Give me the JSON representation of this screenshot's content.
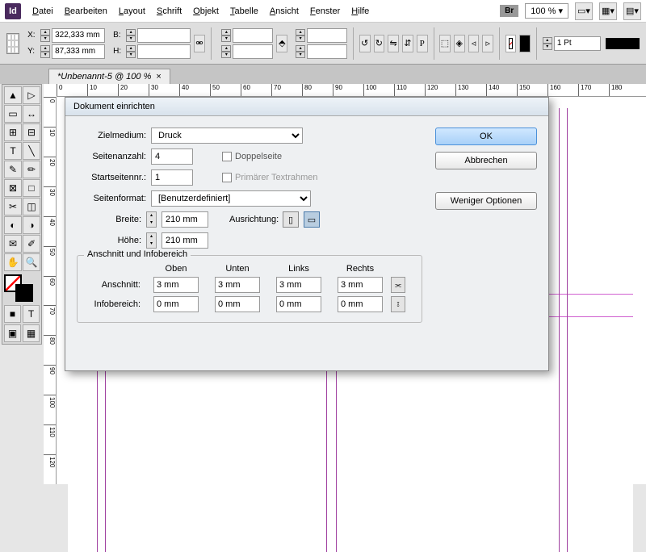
{
  "menubar": {
    "items": [
      "Datei",
      "Bearbeiten",
      "Layout",
      "Schrift",
      "Objekt",
      "Tabelle",
      "Ansicht",
      "Fenster",
      "Hilfe"
    ],
    "br": "Br",
    "zoom": "100 %"
  },
  "toolbar": {
    "x_label": "X:",
    "y_label": "Y:",
    "x": "322,333 mm",
    "y": "87,333 mm",
    "w_label": "B:",
    "h_label": "H:",
    "stroke_weight": "1 Pt"
  },
  "tab": {
    "title": "*Unbenannt-5 @ 100 %",
    "close": "×"
  },
  "ruler": {
    "h": [
      "0",
      "10",
      "20",
      "30",
      "40",
      "50",
      "60",
      "70",
      "80",
      "90",
      "100",
      "110",
      "120",
      "130",
      "140",
      "150",
      "160",
      "170",
      "180"
    ],
    "v": [
      "0",
      "10",
      "20",
      "30",
      "40",
      "50",
      "60",
      "70",
      "80",
      "90",
      "100",
      "110",
      "120"
    ]
  },
  "dialog": {
    "title": "Dokument einrichten",
    "zielmedium_label": "Zielmedium:",
    "zielmedium": "Druck",
    "seitenanzahl_label": "Seitenanzahl:",
    "seitenanzahl": "4",
    "startseite_label": "Startseitennr.:",
    "startseite": "1",
    "doppelseite": "Doppelseite",
    "textrahmen": "Primärer Textrahmen",
    "seitenformat_label": "Seitenformat:",
    "seitenformat": "[Benutzerdefiniert]",
    "breite_label": "Breite:",
    "breite": "210 mm",
    "hoehe_label": "Höhe:",
    "hoehe": "210 mm",
    "ausrichtung_label": "Ausrichtung:",
    "fieldset_title": "Anschnitt und Infobereich",
    "cols": {
      "oben": "Oben",
      "unten": "Unten",
      "links": "Links",
      "rechts": "Rechts"
    },
    "anschnitt_label": "Anschnitt:",
    "anschnitt": {
      "o": "3 mm",
      "u": "3 mm",
      "l": "3 mm",
      "r": "3 mm"
    },
    "info_label": "Infobereich:",
    "info": {
      "o": "0 mm",
      "u": "0 mm",
      "l": "0 mm",
      "r": "0 mm"
    },
    "ok": "OK",
    "cancel": "Abbrechen",
    "less": "Weniger Optionen"
  }
}
